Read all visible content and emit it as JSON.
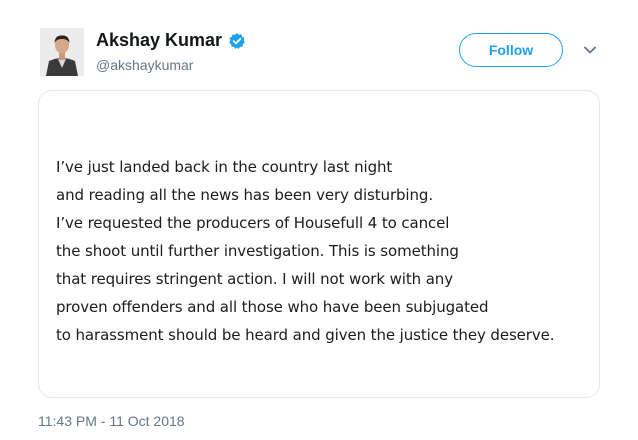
{
  "author": {
    "display_name": "Akshay Kumar",
    "handle": "@akshaykumar",
    "verified": true
  },
  "actions": {
    "follow_label": "Follow"
  },
  "colors": {
    "accent": "#1da1f2",
    "secondary_text": "#657786",
    "border": "#e1e8ed"
  },
  "icons": {
    "verified": "verified-badge-icon",
    "more": "chevron-down-icon"
  },
  "statement": {
    "lines": [
      "I’ve just landed back in the country last night",
      "and reading all the news has been very disturbing.",
      "I’ve requested the producers of Housefull 4 to cancel",
      "the shoot until further investigation. This is something",
      "that requires stringent action. I will not work with any",
      "proven offenders and all those who have been subjugated",
      "to harassment should be heard and given the justice they deserve."
    ]
  },
  "tweet": {
    "timestamp": "11:43 PM - 11 Oct 2018"
  }
}
